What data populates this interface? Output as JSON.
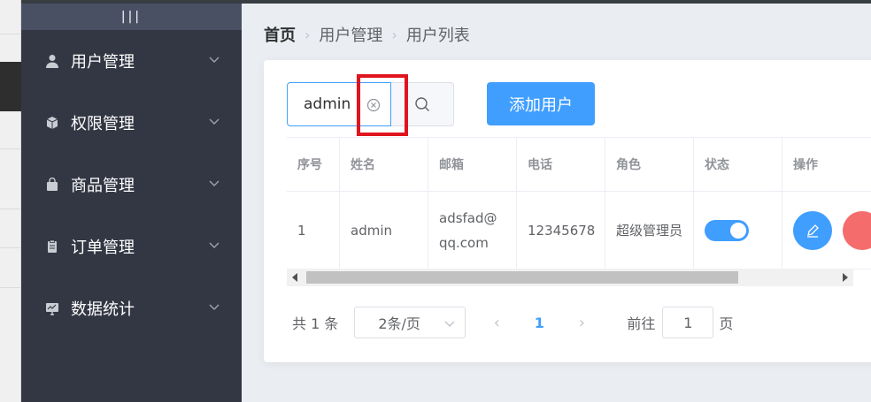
{
  "sidebar": {
    "toggle_label": "|||",
    "items": [
      {
        "label": "用户管理",
        "icon": "user-icon"
      },
      {
        "label": "权限管理",
        "icon": "box-icon"
      },
      {
        "label": "商品管理",
        "icon": "shopping-bag-icon"
      },
      {
        "label": "订单管理",
        "icon": "clipboard-icon"
      },
      {
        "label": "数据统计",
        "icon": "chart-monitor-icon"
      }
    ]
  },
  "breadcrumb": [
    "首页",
    "用户管理",
    "用户列表"
  ],
  "search": {
    "value": "admin"
  },
  "add_button_label": "添加用户",
  "table": {
    "columns": [
      "序号",
      "姓名",
      "邮箱",
      "电话",
      "角色",
      "状态",
      "操作"
    ],
    "rows": [
      {
        "index": "1",
        "name": "admin",
        "email": "adsfad@qq.com",
        "phone": "12345678",
        "role": "超级管理员",
        "status_on": true
      }
    ]
  },
  "pagination": {
    "total": "共 1 条",
    "page_size": "2条/页",
    "current_page": "1",
    "goto_prefix": "前往",
    "goto_value": "1",
    "goto_suffix": "页"
  },
  "colors": {
    "primary": "#409eff",
    "sidebar_bg": "#333744",
    "danger": "#f56c6c",
    "highlight_box": "#e0141e"
  }
}
